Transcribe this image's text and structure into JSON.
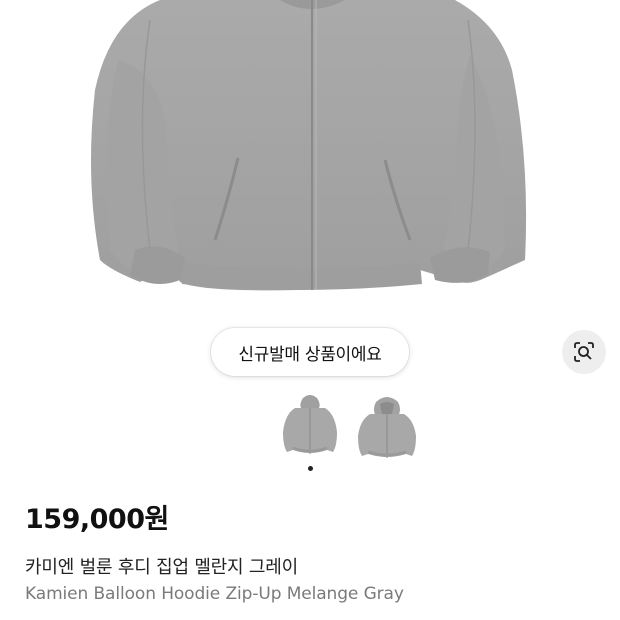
{
  "product_image": {
    "alt_icon": "gray-zip-hoodie-image",
    "color": "#a6a6a6"
  },
  "badge": {
    "label": "신규발매 상품이에요"
  },
  "lens_button": {
    "icon": "visual-search-icon"
  },
  "thumbnails": [
    {
      "icon": "hoodie-thumbnail-front"
    },
    {
      "icon": "hoodie-thumbnail-hooded"
    }
  ],
  "carousel": {
    "active_index": 1,
    "count": 1
  },
  "product": {
    "price": "159,000원",
    "title_ko": "카미엔 벌룬 후디 집업 멜란지 그레이",
    "title_en": "Kamien Balloon Hoodie Zip-Up Melange Gray"
  },
  "colors": {
    "hoodie": "#a7a7a7",
    "hoodie_shadow": "#8f8f8f",
    "secondary_text": "#7a7a7a"
  }
}
